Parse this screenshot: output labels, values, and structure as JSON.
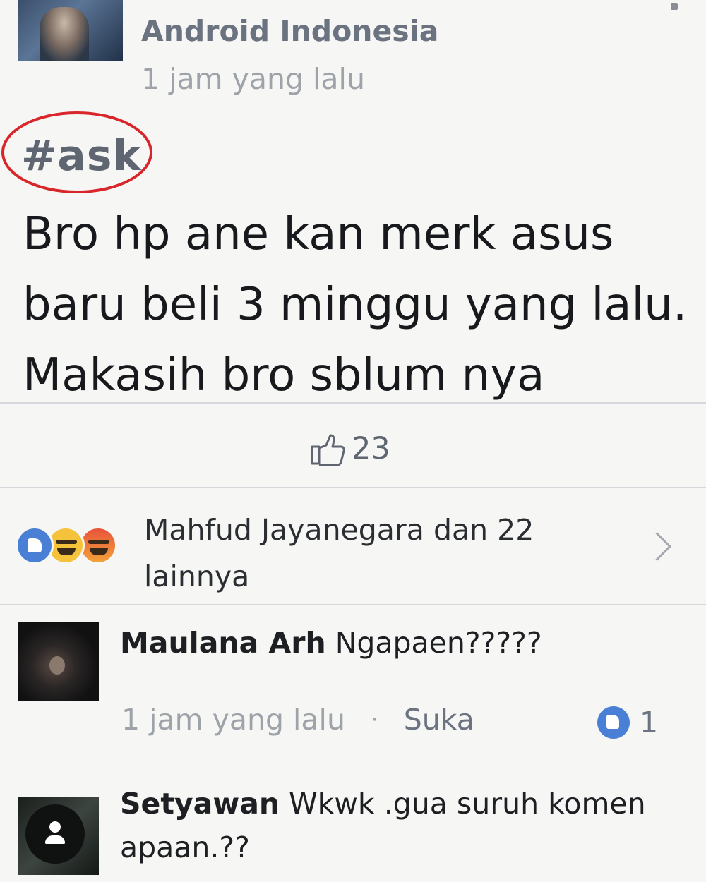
{
  "post": {
    "page_name": "Android Indonesia",
    "time": "1 jam yang lalu",
    "hashtag": "#ask",
    "body": "Bro hp ane kan merk asus baru beli 3 minggu yang lalu. Makasih bro sblum nya",
    "like_count": "23"
  },
  "reactions": {
    "icons": [
      "like-icon",
      "haha-icon",
      "angry-icon"
    ],
    "summary": "Mahfud Jayanegara dan 22 lainnya"
  },
  "comments": [
    {
      "author": "Maulana Arh",
      "text": "Ngapaen?????",
      "time": "1 jam yang lalu",
      "separator": "·",
      "like_label": "Suka",
      "like_count": "1"
    },
    {
      "author": "Setyawan",
      "text": "Wkwk .gua suruh komen apaan.??"
    }
  ],
  "colors": {
    "accent_blue": "#4a7fd6",
    "highlight_red": "#d8262b",
    "background": "#f6f7f5"
  }
}
